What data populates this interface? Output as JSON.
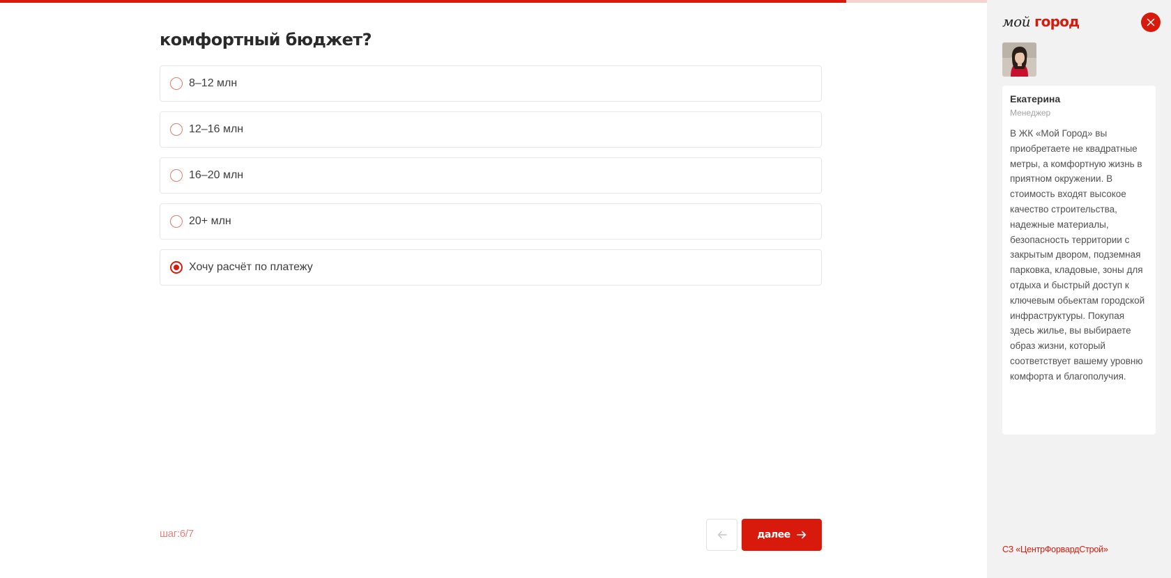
{
  "progress": {
    "fraction": 0.857
  },
  "question": {
    "title": "комфортный бюджет?"
  },
  "options": [
    {
      "label": "8–12 млн",
      "selected": false
    },
    {
      "label": "12–16 млн",
      "selected": false
    },
    {
      "label": "16–20 млн",
      "selected": false
    },
    {
      "label": "20+ млн",
      "selected": false
    },
    {
      "label": "Хочу расчёт по платежу",
      "selected": true
    }
  ],
  "nav": {
    "step_label": "шаг:6/7",
    "next_label": "далее"
  },
  "sidebar": {
    "brand_part1": "мой",
    "brand_part2": "город",
    "manager_name": "Екатерина",
    "manager_role": "Менеджер",
    "manager_text": "В ЖК «Мой Город» вы приобретаете не квадратные метры, а комфортную жизнь в приятном окружении. В стоимость входят высокое качество строительства, надежные материалы, безопасность территории с закрытым двором, подземная парковка, кладовые, зоны для отдыха и быстрый доступ к ключевым обьектам городской инфраструктуры. Покупая здесь жилье, вы выбираете образ жизни, который соответствует вашему уровню комфорта и благополучия.",
    "company": "СЗ «ЦентрФорвардСтрой»"
  },
  "colors": {
    "accent": "#d71a0c",
    "progress_track": "#f6d3cf",
    "panel_bg": "#f2f2f2"
  }
}
